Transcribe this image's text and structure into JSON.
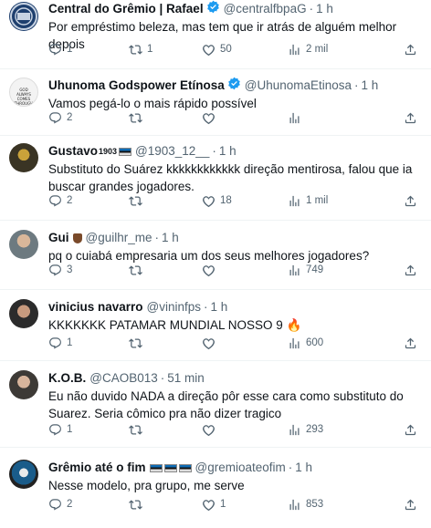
{
  "tweets": [
    {
      "name": "Central do Grêmio | Rafael",
      "handle": "@centralfbpaG",
      "time": "1 h",
      "text": "Por empréstimo beleza, mas tem que ir atrás de alguém melhor depois",
      "replies": "1",
      "retweets": "1",
      "likes": "50",
      "views": "2 mil"
    },
    {
      "name": "Uhunoma Godspower Etínosa",
      "handle": "@UhunomaEtinosa",
      "time": "1 h",
      "text": "Vamos pegá-lo o mais rápido possível",
      "replies": "2",
      "retweets": "",
      "likes": "",
      "views": "",
      "avatar_text": "GOD ALWAYS COMES THROUGH"
    },
    {
      "name": "Gustavo",
      "name_suffix": "1903",
      "handle": "@1903_12__",
      "time": "1 h",
      "text": "Substituto do Suárez kkkkkkkkkkkk direção mentirosa, falou que ia buscar grandes jogadores.",
      "replies": "2",
      "retweets": "",
      "likes": "18",
      "views": "1 mil"
    },
    {
      "name": "Gui",
      "handle": "@guilhr_me",
      "time": "1 h",
      "text": "pq o cuiabá empresaria um dos seus melhores jogadores?",
      "replies": "3",
      "retweets": "",
      "likes": "",
      "views": "749"
    },
    {
      "name": "vinicius navarro",
      "handle": "@vininfps",
      "time": "1 h",
      "text": "KKKKKKK PATAMAR MUNDIAL NOSSO 9 🔥",
      "replies": "1",
      "retweets": "",
      "likes": "",
      "views": "600"
    },
    {
      "name": "K.O.B.",
      "handle": "@CAOB013",
      "time": "51 min",
      "text": "Eu não duvido NADA a direção pôr esse cara como substituto do Suarez. Seria cômico pra não dizer tragico",
      "replies": "1",
      "retweets": "",
      "likes": "",
      "views": "293"
    },
    {
      "name": "Grêmio até o fim",
      "handle": "@gremioateofim",
      "time": "1 h",
      "text": "Nesse modelo, pra grupo, me serve",
      "replies": "2",
      "retweets": "",
      "likes": "1",
      "views": "853"
    }
  ],
  "colors": {
    "text": "#0f1419",
    "secondary": "#536471",
    "verified": "#1d9bf0",
    "gold": "#e2b719"
  },
  "icons": [
    "reply-icon",
    "retweet-icon",
    "like-icon",
    "views-icon",
    "verified-badge-icon",
    "fire-icon"
  ]
}
